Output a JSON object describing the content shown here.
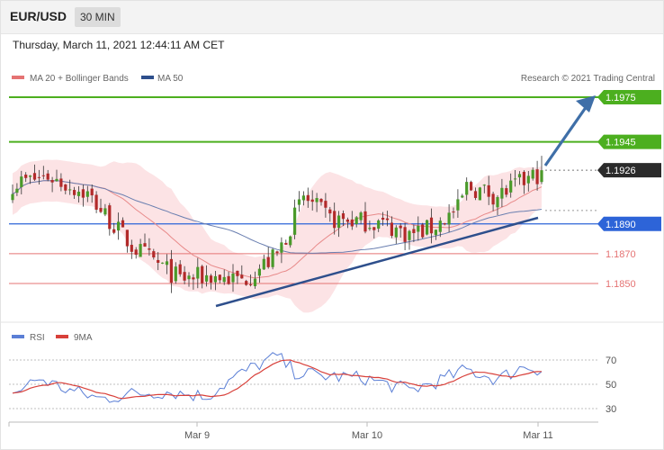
{
  "header": {
    "pair": "EUR/USD",
    "timeframe": "30 MIN",
    "datetime": "Thursday, March 11, 2021 12:44:11 AM CET"
  },
  "legend": {
    "bollinger": "MA 20 + Bollinger Bands",
    "ma50": "MA 50",
    "copyright": "Research © 2021 Trading Central",
    "rsi": "RSI",
    "rsi_ma": "9MA"
  },
  "colors": {
    "resistance_green": "#4caf1f",
    "support_blue": "#2d64d8",
    "support_red": "#e57373",
    "trendline": "#2e4f8c",
    "last_price_bg": "#2b2b2b",
    "band_fill": "#fbd9dc",
    "candle_up": "#4a9a2a",
    "candle_down": "#b22a2a",
    "rsi_line": "#5b7fd6",
    "rsi_ma_line": "#d8403a"
  },
  "levels": [
    {
      "label": "1.1975",
      "value": 1.1975,
      "style": "resistance"
    },
    {
      "label": "1.1945",
      "value": 1.1945,
      "style": "resistance"
    },
    {
      "label": "1.1926",
      "value": 1.1926,
      "style": "last"
    },
    {
      "label": "1.1890",
      "value": 1.189,
      "style": "pivot"
    },
    {
      "label": "1.1870",
      "value": 1.187,
      "style": "support"
    },
    {
      "label": "1.1850",
      "value": 1.185,
      "style": "support"
    }
  ],
  "rsi_levels": [
    "70",
    "50",
    "30"
  ],
  "x_labels": [
    "Mar 9",
    "Mar 10",
    "Mar 11"
  ],
  "chart_data": {
    "type": "line",
    "title": "EUR/USD",
    "x_labels": [
      "Mar 9",
      "Mar 10",
      "Mar 11"
    ],
    "price_anchors": {
      "x": [
        0,
        8,
        17,
        27,
        38,
        45,
        52,
        60,
        66,
        72,
        83,
        90,
        95,
        101,
        103,
        110,
        117,
        120
      ],
      "close": [
        1.1917,
        1.1922,
        1.191,
        1.1875,
        1.1853,
        1.1855,
        1.1852,
        1.1869,
        1.1908,
        1.1893,
        1.1891,
        1.1883,
        1.1887,
        1.19,
        1.1915,
        1.1909,
        1.192,
        1.1925
      ]
    },
    "rsi_anchors": {
      "x": [
        0,
        6,
        12,
        20,
        27,
        35,
        44,
        50,
        55,
        60,
        64,
        70,
        80,
        90,
        96,
        103,
        110,
        116,
        120
      ],
      "value": [
        42,
        55,
        46,
        38,
        42,
        44,
        40,
        55,
        65,
        73,
        60,
        57,
        55,
        45,
        52,
        62,
        54,
        65,
        62
      ]
    },
    "series": [
      {
        "name": "MA 20 + Bollinger Bands"
      },
      {
        "name": "MA 50"
      },
      {
        "name": "RSI"
      },
      {
        "name": "9MA"
      }
    ],
    "ylim": [
      1.183,
      1.1985
    ],
    "rsi_ylim": [
      20,
      80
    ]
  }
}
